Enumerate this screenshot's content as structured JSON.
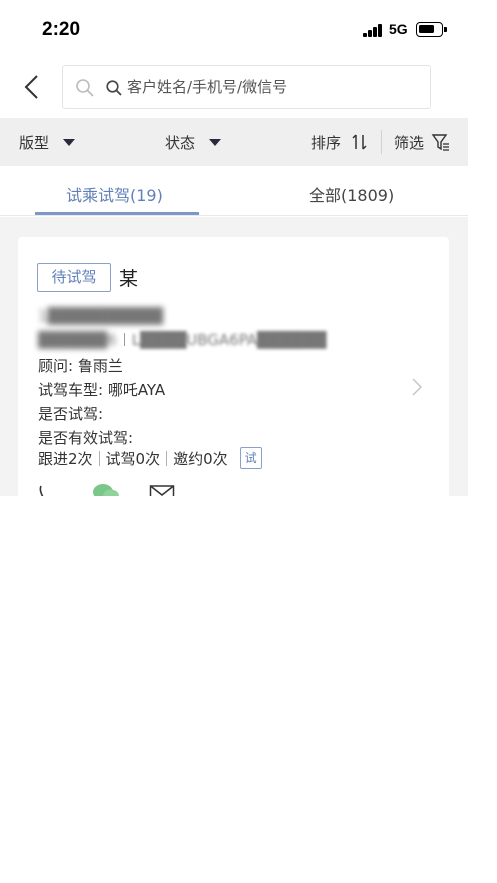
{
  "status_bar": {
    "time": "2:20",
    "network": "5G"
  },
  "search": {
    "placeholder": "客户姓名/手机号/微信号"
  },
  "filters": {
    "model": "版型",
    "status": "状态",
    "sort": "排序",
    "filter": "筛选"
  },
  "tabs": [
    {
      "label": "试乘试驾(19)",
      "active": true
    },
    {
      "label": "全部(1809)",
      "active": false
    }
  ],
  "card": {
    "tag": "待试驾",
    "name": "某",
    "phone": "1██████████",
    "id_prefix": "██████6",
    "vin": "L████UBGA6PA██████",
    "advisor": "顾问: 鲁雨兰",
    "test_model": "试驾车型: 哪吒AYA",
    "is_test_drive": "是否试驾:",
    "is_valid_test_drive": "是否有效试驾:",
    "stats": [
      "跟进2次",
      "试驾0次",
      "邀约0次"
    ],
    "mini_tag": "试"
  },
  "colors": {
    "accent": "#5f80b8",
    "filter_bg": "#efefef",
    "list_bg": "#f3f3f3",
    "wechat": "#7bc78a"
  },
  "icons": [
    "back-icon",
    "search-icon",
    "triangle-down-icon",
    "sort-icon",
    "filter-funnel-icon",
    "chevron-right-icon",
    "phone-icon",
    "wechat-icon",
    "mail-icon"
  ]
}
